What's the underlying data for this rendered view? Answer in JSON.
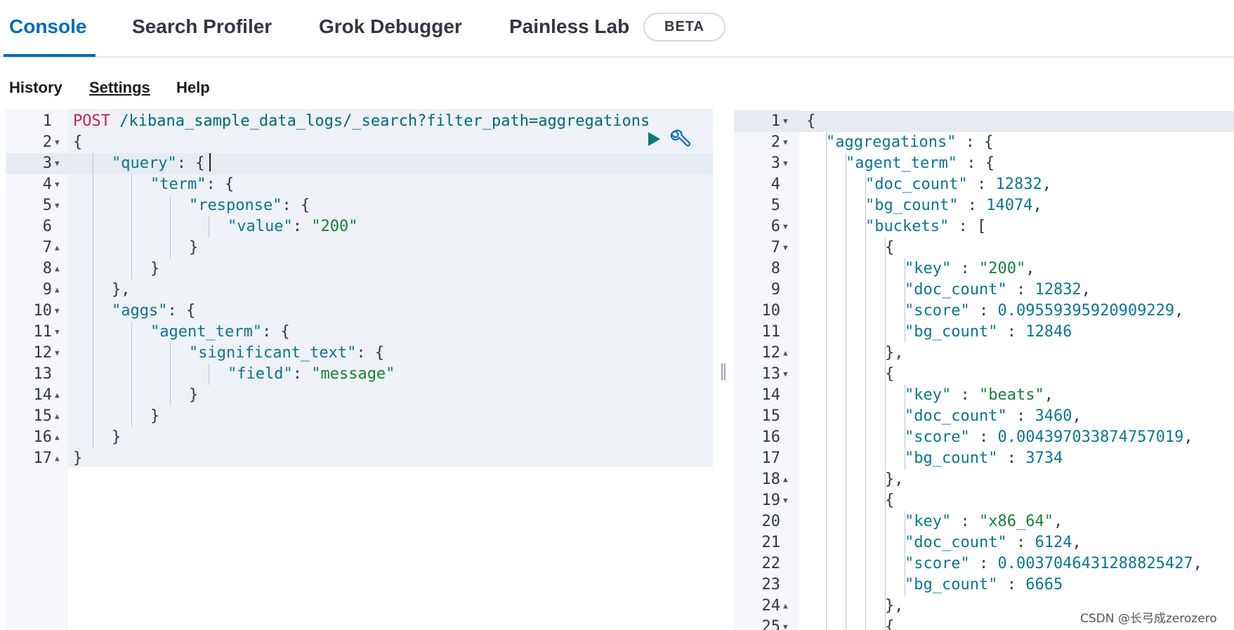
{
  "tabs": {
    "console": "Console",
    "search_profiler": "Search Profiler",
    "grok_debugger": "Grok Debugger",
    "painless_lab": "Painless Lab",
    "beta_badge": "BETA"
  },
  "subnav": {
    "history": "History",
    "settings": "Settings",
    "help": "Help"
  },
  "request": {
    "method": "POST",
    "url": " /kibana_sample_data_logs/_search?filter_path=aggregations",
    "lines": [
      {
        "n": "1",
        "fold": "",
        "indent": 0,
        "tokens": []
      },
      {
        "n": "2",
        "fold": "down",
        "indent": 0,
        "tokens": [
          [
            "p",
            "{"
          ]
        ]
      },
      {
        "n": "3",
        "fold": "down",
        "indent": 1,
        "tokens": [
          [
            "key",
            "\"query\""
          ],
          [
            "p",
            ": {"
          ]
        ]
      },
      {
        "n": "4",
        "fold": "down",
        "indent": 2,
        "tokens": [
          [
            "key",
            "\"term\""
          ],
          [
            "p",
            ": {"
          ]
        ]
      },
      {
        "n": "5",
        "fold": "down",
        "indent": 3,
        "tokens": [
          [
            "key",
            "\"response\""
          ],
          [
            "p",
            ": {"
          ]
        ]
      },
      {
        "n": "6",
        "fold": "",
        "indent": 4,
        "tokens": [
          [
            "key",
            "\"value\""
          ],
          [
            "p",
            ": "
          ],
          [
            "str",
            "\"200\""
          ]
        ]
      },
      {
        "n": "7",
        "fold": "up",
        "indent": 3,
        "tokens": [
          [
            "p",
            "}"
          ]
        ]
      },
      {
        "n": "8",
        "fold": "up",
        "indent": 2,
        "tokens": [
          [
            "p",
            "}"
          ]
        ]
      },
      {
        "n": "9",
        "fold": "up",
        "indent": 1,
        "tokens": [
          [
            "p",
            "},"
          ]
        ]
      },
      {
        "n": "10",
        "fold": "down",
        "indent": 1,
        "tokens": [
          [
            "key",
            "\"aggs\""
          ],
          [
            "p",
            ": {"
          ]
        ]
      },
      {
        "n": "11",
        "fold": "down",
        "indent": 2,
        "tokens": [
          [
            "key",
            "\"agent_term\""
          ],
          [
            "p",
            ": {"
          ]
        ]
      },
      {
        "n": "12",
        "fold": "down",
        "indent": 3,
        "tokens": [
          [
            "key",
            "\"significant_text\""
          ],
          [
            "p",
            ": {"
          ]
        ]
      },
      {
        "n": "13",
        "fold": "",
        "indent": 4,
        "tokens": [
          [
            "key",
            "\"field\""
          ],
          [
            "p",
            ": "
          ],
          [
            "str",
            "\"message\""
          ]
        ]
      },
      {
        "n": "14",
        "fold": "up",
        "indent": 3,
        "tokens": [
          [
            "p",
            "}"
          ]
        ]
      },
      {
        "n": "15",
        "fold": "up",
        "indent": 2,
        "tokens": [
          [
            "p",
            "}"
          ]
        ]
      },
      {
        "n": "16",
        "fold": "up",
        "indent": 1,
        "tokens": [
          [
            "p",
            "}"
          ]
        ]
      },
      {
        "n": "17",
        "fold": "up",
        "indent": 0,
        "tokens": [
          [
            "p",
            "}"
          ]
        ]
      }
    ]
  },
  "response": {
    "lines": [
      {
        "n": "1",
        "fold": "down",
        "indent": 0,
        "tokens": [
          [
            "p",
            "{"
          ]
        ]
      },
      {
        "n": "2",
        "fold": "down",
        "indent": 1,
        "tokens": [
          [
            "key",
            "\"aggregations\""
          ],
          [
            "p",
            " : {"
          ]
        ]
      },
      {
        "n": "3",
        "fold": "down",
        "indent": 2,
        "tokens": [
          [
            "key",
            "\"agent_term\""
          ],
          [
            "p",
            " : {"
          ]
        ]
      },
      {
        "n": "4",
        "fold": "",
        "indent": 3,
        "tokens": [
          [
            "key",
            "\"doc_count\""
          ],
          [
            "p",
            " : "
          ],
          [
            "num",
            "12832"
          ],
          [
            "p",
            ","
          ]
        ]
      },
      {
        "n": "5",
        "fold": "",
        "indent": 3,
        "tokens": [
          [
            "key",
            "\"bg_count\""
          ],
          [
            "p",
            " : "
          ],
          [
            "num",
            "14074"
          ],
          [
            "p",
            ","
          ]
        ]
      },
      {
        "n": "6",
        "fold": "down",
        "indent": 3,
        "tokens": [
          [
            "key",
            "\"buckets\""
          ],
          [
            "p",
            " : ["
          ]
        ]
      },
      {
        "n": "7",
        "fold": "down",
        "indent": 4,
        "tokens": [
          [
            "p",
            "{"
          ]
        ]
      },
      {
        "n": "8",
        "fold": "",
        "indent": 5,
        "tokens": [
          [
            "key",
            "\"key\""
          ],
          [
            "p",
            " : "
          ],
          [
            "str",
            "\"200\""
          ],
          [
            "p",
            ","
          ]
        ]
      },
      {
        "n": "9",
        "fold": "",
        "indent": 5,
        "tokens": [
          [
            "key",
            "\"doc_count\""
          ],
          [
            "p",
            " : "
          ],
          [
            "num",
            "12832"
          ],
          [
            "p",
            ","
          ]
        ]
      },
      {
        "n": "10",
        "fold": "",
        "indent": 5,
        "tokens": [
          [
            "key",
            "\"score\""
          ],
          [
            "p",
            " : "
          ],
          [
            "num",
            "0.09559395920909229"
          ],
          [
            "p",
            ","
          ]
        ]
      },
      {
        "n": "11",
        "fold": "",
        "indent": 5,
        "tokens": [
          [
            "key",
            "\"bg_count\""
          ],
          [
            "p",
            " : "
          ],
          [
            "num",
            "12846"
          ]
        ]
      },
      {
        "n": "12",
        "fold": "up",
        "indent": 4,
        "tokens": [
          [
            "p",
            "},"
          ]
        ]
      },
      {
        "n": "13",
        "fold": "down",
        "indent": 4,
        "tokens": [
          [
            "p",
            "{"
          ]
        ]
      },
      {
        "n": "14",
        "fold": "",
        "indent": 5,
        "tokens": [
          [
            "key",
            "\"key\""
          ],
          [
            "p",
            " : "
          ],
          [
            "str",
            "\"beats\""
          ],
          [
            "p",
            ","
          ]
        ]
      },
      {
        "n": "15",
        "fold": "",
        "indent": 5,
        "tokens": [
          [
            "key",
            "\"doc_count\""
          ],
          [
            "p",
            " : "
          ],
          [
            "num",
            "3460"
          ],
          [
            "p",
            ","
          ]
        ]
      },
      {
        "n": "16",
        "fold": "",
        "indent": 5,
        "tokens": [
          [
            "key",
            "\"score\""
          ],
          [
            "p",
            " : "
          ],
          [
            "num",
            "0.004397033874757019"
          ],
          [
            "p",
            ","
          ]
        ]
      },
      {
        "n": "17",
        "fold": "",
        "indent": 5,
        "tokens": [
          [
            "key",
            "\"bg_count\""
          ],
          [
            "p",
            " : "
          ],
          [
            "num",
            "3734"
          ]
        ]
      },
      {
        "n": "18",
        "fold": "up",
        "indent": 4,
        "tokens": [
          [
            "p",
            "},"
          ]
        ]
      },
      {
        "n": "19",
        "fold": "down",
        "indent": 4,
        "tokens": [
          [
            "p",
            "{"
          ]
        ]
      },
      {
        "n": "20",
        "fold": "",
        "indent": 5,
        "tokens": [
          [
            "key",
            "\"key\""
          ],
          [
            "p",
            " : "
          ],
          [
            "str",
            "\"x86_64\""
          ],
          [
            "p",
            ","
          ]
        ]
      },
      {
        "n": "21",
        "fold": "",
        "indent": 5,
        "tokens": [
          [
            "key",
            "\"doc_count\""
          ],
          [
            "p",
            " : "
          ],
          [
            "num",
            "6124"
          ],
          [
            "p",
            ","
          ]
        ]
      },
      {
        "n": "22",
        "fold": "",
        "indent": 5,
        "tokens": [
          [
            "key",
            "\"score\""
          ],
          [
            "p",
            " : "
          ],
          [
            "num",
            "0.0037046431288825427"
          ],
          [
            "p",
            ","
          ]
        ]
      },
      {
        "n": "23",
        "fold": "",
        "indent": 5,
        "tokens": [
          [
            "key",
            "\"bg_count\""
          ],
          [
            "p",
            " : "
          ],
          [
            "num",
            "6665"
          ]
        ]
      },
      {
        "n": "24",
        "fold": "up",
        "indent": 4,
        "tokens": [
          [
            "p",
            "},"
          ]
        ]
      },
      {
        "n": "25",
        "fold": "down",
        "indent": 4,
        "tokens": [
          [
            "p",
            "{"
          ]
        ]
      }
    ]
  },
  "icons": {
    "run": "play-icon",
    "wrench": "wrench-icon",
    "splitter": "resize-grip-icon"
  },
  "colors": {
    "accent": "#006bb8",
    "method": "#c7254e",
    "string": "#1a7f37",
    "key": "#0e7490"
  },
  "watermark": "CSDN @长弓成zerozero"
}
